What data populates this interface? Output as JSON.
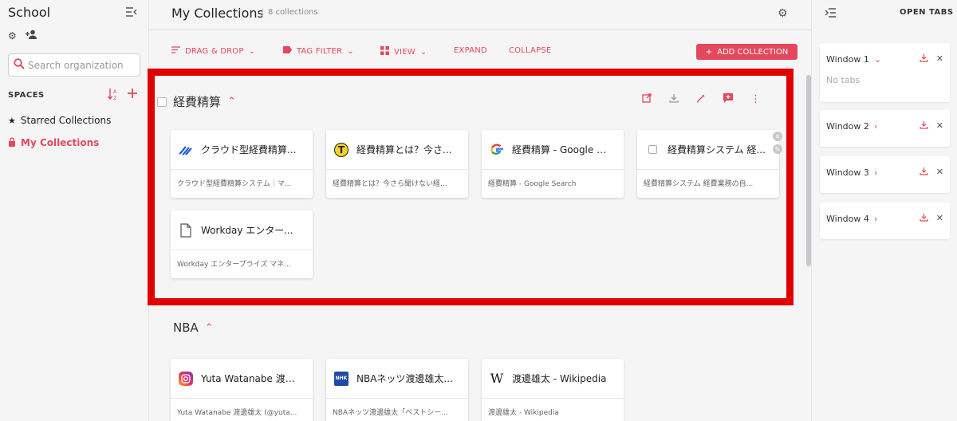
{
  "sidebar": {
    "workspace": "School",
    "search_placeholder": "Search organization",
    "spaces_label": "SPACES",
    "items": [
      {
        "label": "Starred Collections",
        "icon": "star-icon"
      },
      {
        "label": "My Collections",
        "icon": "lock-icon",
        "active": true
      }
    ]
  },
  "header": {
    "title": "My Collections",
    "count": "8 collections"
  },
  "toolbar": {
    "drag_drop": "DRAG & DROP",
    "tag_filter": "TAG FILTER",
    "view": "VIEW",
    "expand": "EXPAND",
    "collapse": "COLLAPSE",
    "add_collection": "ADD COLLECTION"
  },
  "collections": [
    {
      "name": "経費精算",
      "cards": [
        {
          "title": "クラウド型経費精算...",
          "url": "クラウド型経費精算システム｜マ...",
          "favicon": "wave"
        },
        {
          "title": "経費精算とは？今さ...",
          "url": "経費精算とは？今さら聞けない経...",
          "favicon": "t"
        },
        {
          "title": "経費精算 - Google Se...",
          "url": "経費精算 - Google Search",
          "favicon": "google"
        },
        {
          "title": "経費精算システム 経...",
          "url": "経費精算システム 経費業務の自...",
          "favicon": "checkbox"
        },
        {
          "title": "Workday エンタープ...",
          "url": "Workday エンタープライズ マネ...",
          "favicon": "doc"
        }
      ]
    },
    {
      "name": "NBA",
      "cards": [
        {
          "title": "Yuta Watanabe 渡邊...",
          "url": "Yuta Watanabe 渡邊雄太 (@yuta...",
          "favicon": "instagram"
        },
        {
          "title": "NBAネッツ渡邊雄太...",
          "url": "NBAネッツ渡邊雄太「ベストシー...",
          "favicon": "nhk"
        },
        {
          "title": "渡邊雄太 - Wikipedia",
          "url": "渡邊雄太 - Wikipedia",
          "favicon": "wikipedia"
        }
      ]
    }
  ],
  "right_panel": {
    "title": "OPEN TABS",
    "windows": [
      {
        "label": "Window 1",
        "expanded": true,
        "empty_text": "No tabs"
      },
      {
        "label": "Window 2"
      },
      {
        "label": "Window 3"
      },
      {
        "label": "Window 4"
      }
    ]
  },
  "colors": {
    "accent": "#e5475d",
    "highlight": "#e00000"
  }
}
